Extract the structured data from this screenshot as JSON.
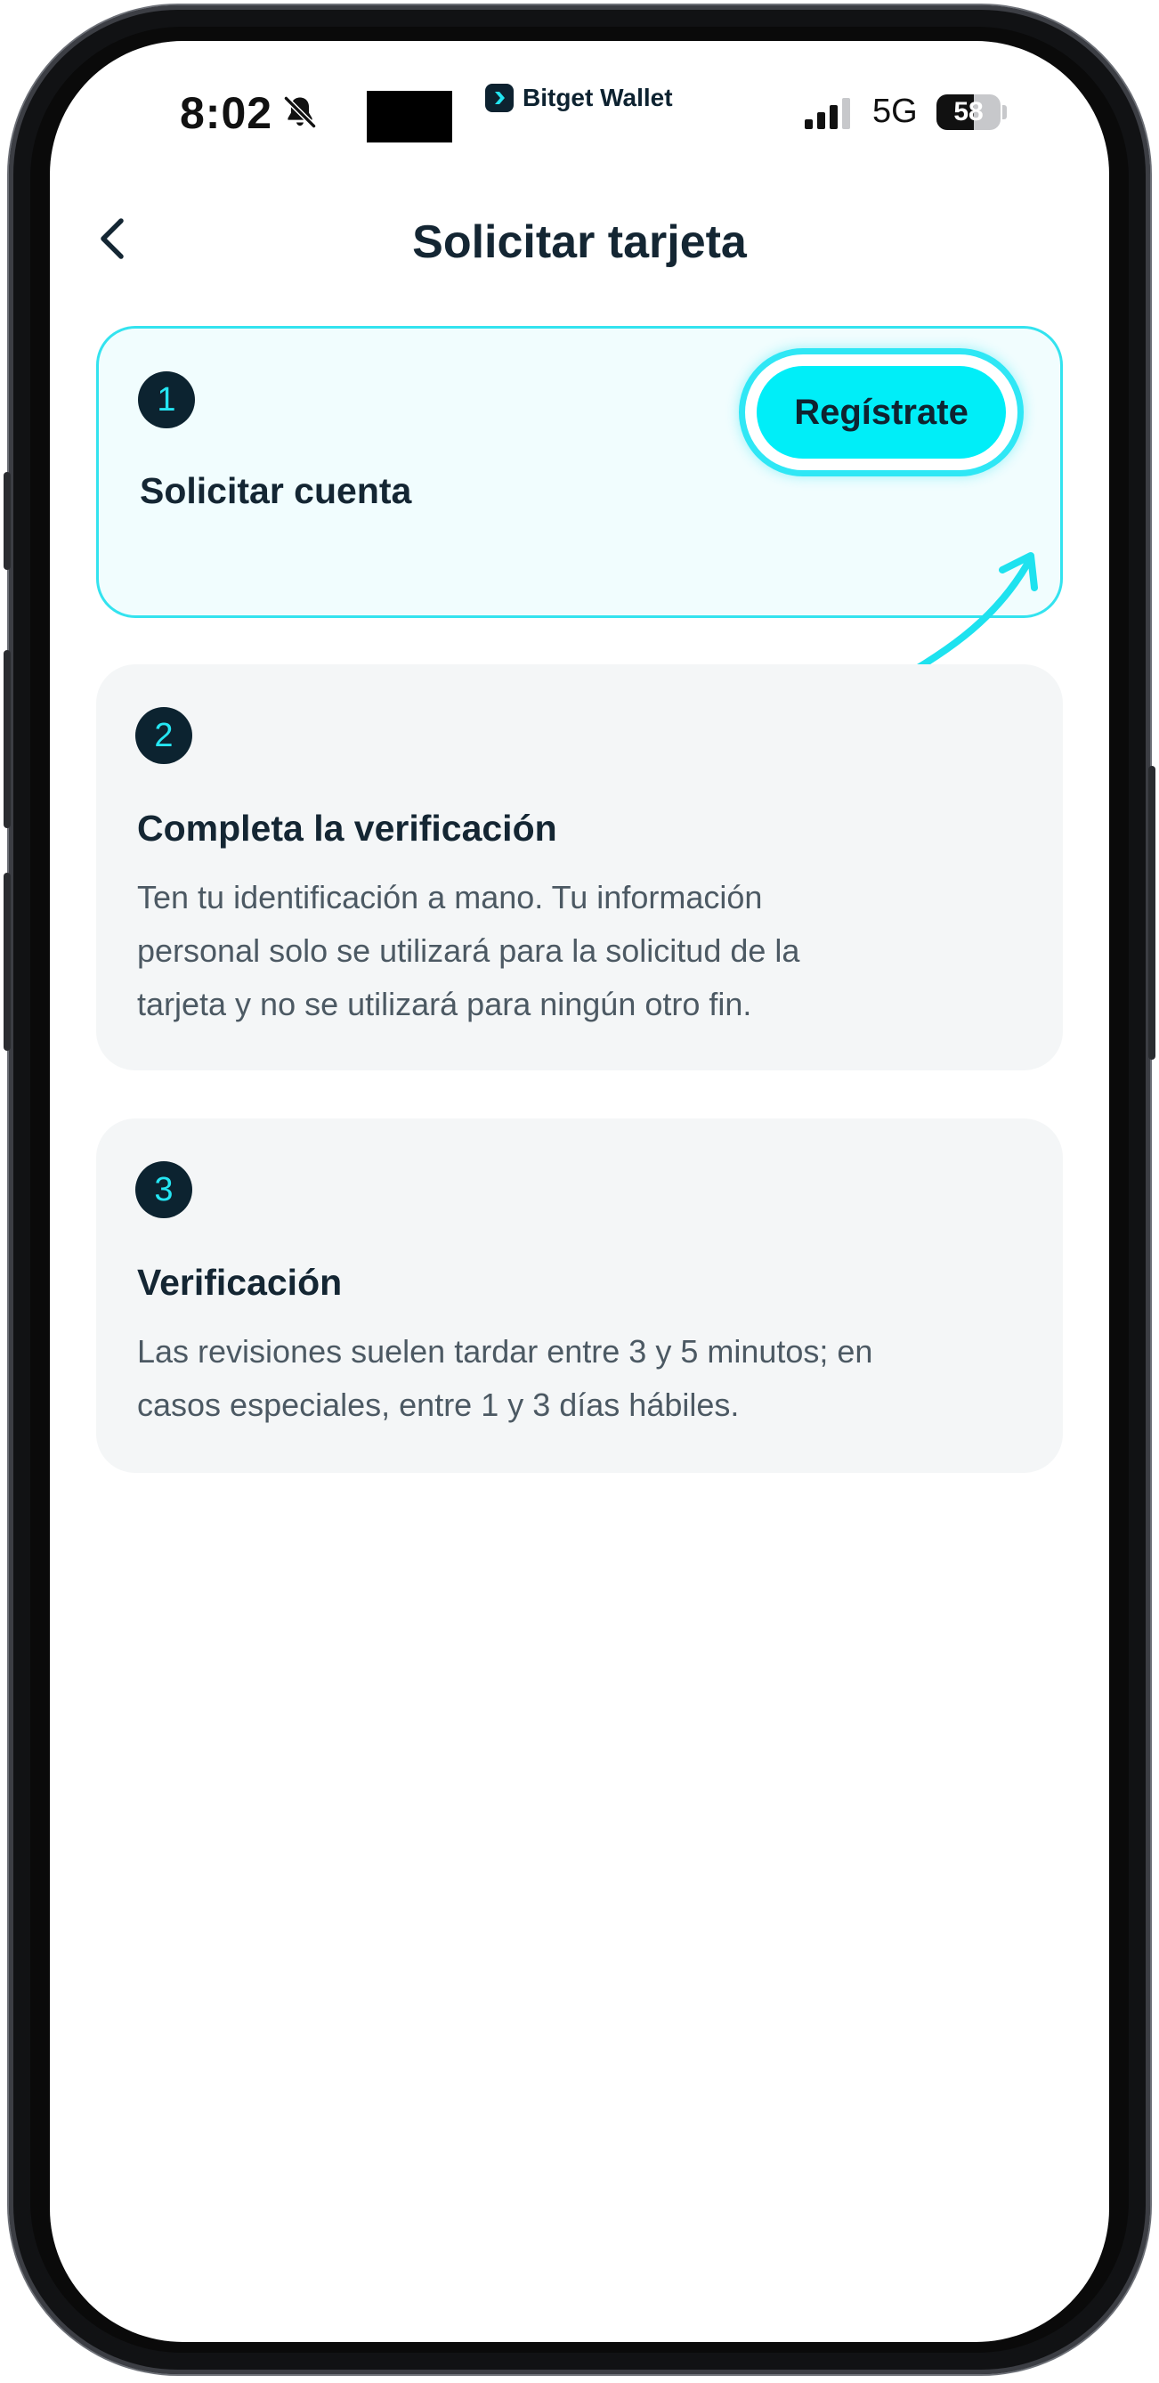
{
  "status_bar": {
    "time": "8:02",
    "network": "5G",
    "battery_level": "58",
    "battery_fraction": 0.58,
    "icons": [
      "bell-slash-icon",
      "signal-icon"
    ]
  },
  "brand": {
    "name": "Bitget Wallet",
    "logo_icon": "bitget-logo-icon"
  },
  "header": {
    "title": "Solicitar tarjeta",
    "back_icon": "chevron-left-icon"
  },
  "steps": [
    {
      "number": "1",
      "title": "Solicitar cuenta",
      "action_label": "Regístrate",
      "active": true
    },
    {
      "number": "2",
      "title": "Completa la verificación",
      "description_lines": [
        "Ten tu identificación a mano. Tu información",
        "personal solo se utilizará para la solicitud de la",
        "tarjeta y no se utilizará para ningún otro fin."
      ]
    },
    {
      "number": "3",
      "title": "Verificación",
      "description_lines": [
        "Las revisiones suelen tardar entre 3 y 5 minutos; en",
        "casos especiales, entre 1 y 3 días hábiles."
      ]
    }
  ],
  "colors": {
    "accent": "#00eef8",
    "accent_border": "#33e3ef",
    "badge_bg": "#0c2330",
    "card_bg": "#f4f6f7",
    "title_text": "#142633",
    "body_text": "#4c5963"
  }
}
